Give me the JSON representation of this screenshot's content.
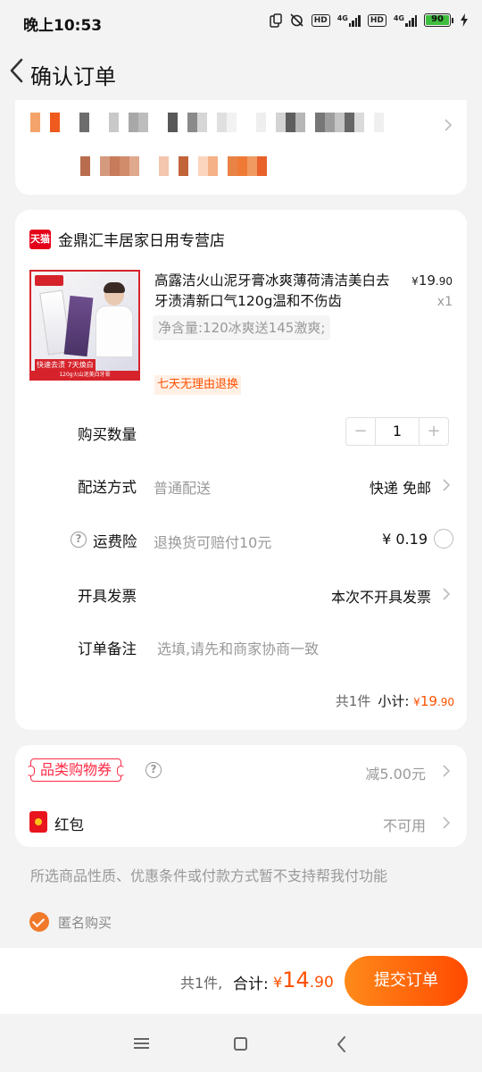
{
  "status_bar": {
    "time": "晚上10:53",
    "hd1": "HD",
    "net1": "4G",
    "hd2": "HD",
    "net2": "4G",
    "battery": "90"
  },
  "header": {
    "title": "确认订单"
  },
  "store": {
    "badge": "天猫",
    "name": "金鼎汇丰居家日用专营店"
  },
  "product": {
    "title": "高露洁火山泥牙膏冰爽薄荷清洁美白去牙渍清新口气120g温和不伤齿",
    "price_currency": "¥",
    "price_int": "19",
    "price_dec": ".90",
    "qty": "x1",
    "spec": "净含量:120冰爽送145激爽;",
    "tag": "七天无理由退换",
    "image_badge": "快速去渍 7天焕白",
    "image_strip": "120g火山泥美白牙膏"
  },
  "rows": {
    "quantity": {
      "label": "购买数量",
      "value": "1",
      "minus": "−",
      "plus": "+"
    },
    "delivery": {
      "label": "配送方式",
      "sub": "普通配送",
      "value": "快递 免邮"
    },
    "insurance": {
      "label": "运费险",
      "sub": "退换货可赔付10元",
      "value": "¥ 0.19"
    },
    "invoice": {
      "label": "开具发票",
      "value": "本次不开具发票"
    },
    "note": {
      "label": "订单备注",
      "placeholder": "选填,请先和商家协商一致"
    }
  },
  "subtotal": {
    "count": "共1件",
    "label": "小计:",
    "currency": "¥",
    "int": "19",
    "dec": ".90"
  },
  "promo": {
    "coupon": {
      "label": "品类购物券",
      "value": "减5.00元"
    },
    "redpacket": {
      "label": "红包",
      "value": "不可用"
    }
  },
  "notice": "所选商品性质、优惠条件或付款方式暂不支持帮我付功能",
  "anonymous": {
    "label": "匿名购买",
    "checked": true
  },
  "footer": {
    "count": "共1件,",
    "total_label": "合计:",
    "currency": "¥",
    "int": "14",
    "dec": ".90",
    "submit": "提交订单"
  },
  "colors": {
    "accent": "#ff5000",
    "tmall_red": "#e5001a",
    "coupon_red": "#ff2a45",
    "background": "#f3f3f3"
  }
}
